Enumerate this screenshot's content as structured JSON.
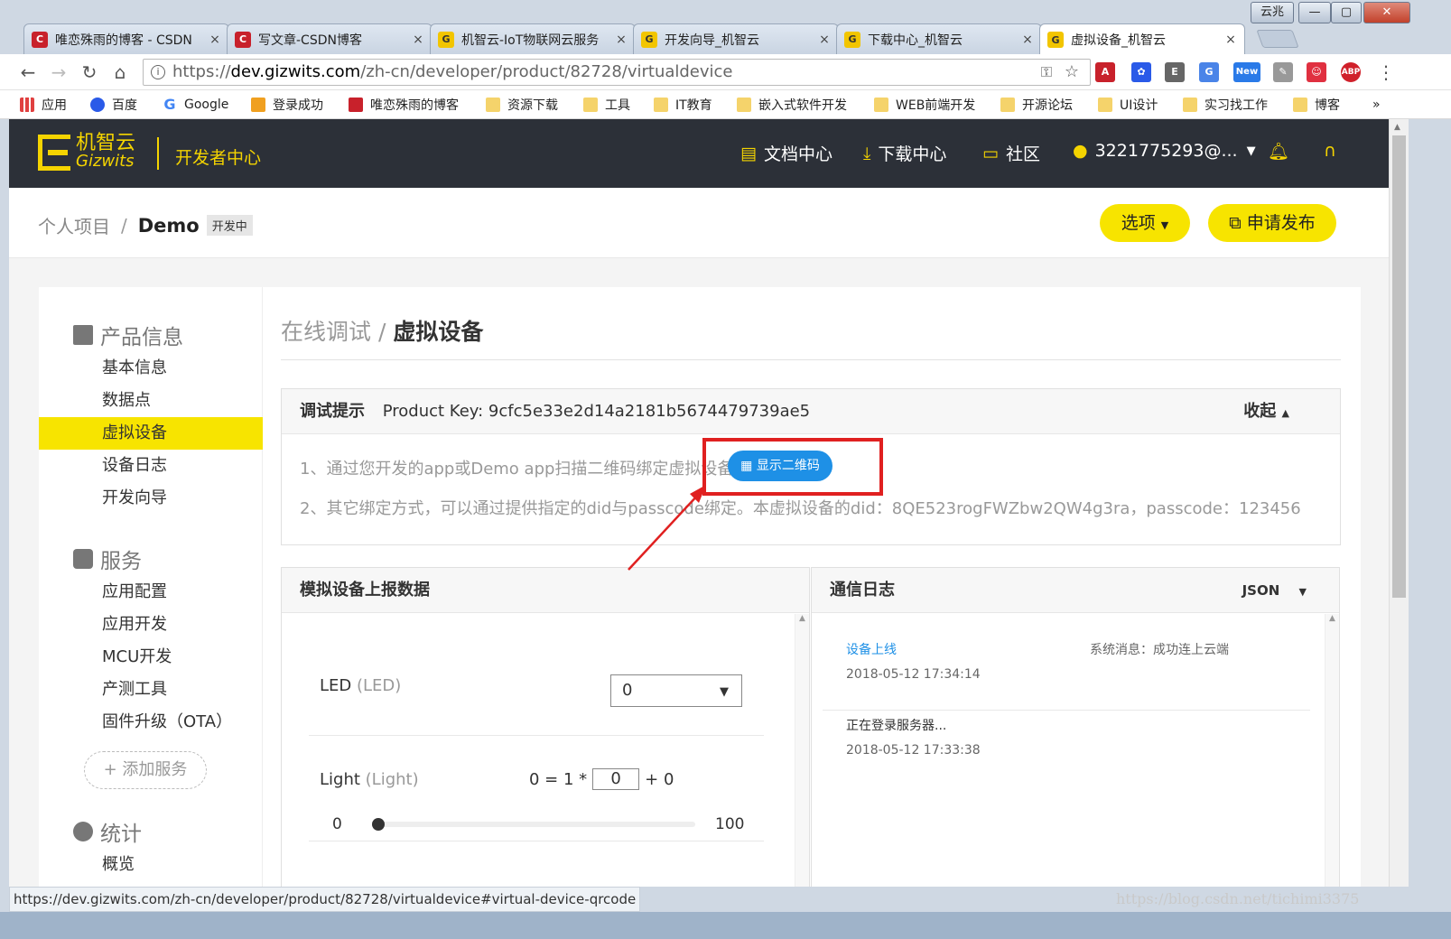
{
  "window": {
    "title_btn": "云兆",
    "min": "—",
    "max": "▢",
    "close": "✕"
  },
  "tabs": [
    {
      "label": "唯恋殊雨的博客 - CSDN",
      "favicon": "c"
    },
    {
      "label": "写文章-CSDN博客",
      "favicon": "c"
    },
    {
      "label": "机智云-IoT物联网云服务",
      "favicon": "g"
    },
    {
      "label": "开发向导_机智云",
      "favicon": "g"
    },
    {
      "label": "下载中心_机智云",
      "favicon": "g"
    },
    {
      "label": "虚拟设备_机智云",
      "favicon": "g",
      "active": true
    }
  ],
  "tab_close": "×",
  "address": {
    "scheme": "https://",
    "host": "dev.gizwits.com",
    "path": "/zh-cn/developer/product/82728/virtualdevice"
  },
  "bookmarks": [
    {
      "label": "应用",
      "icon": "apps-grid"
    },
    {
      "label": "百度",
      "icon": "baidu-paw"
    },
    {
      "label": "Google",
      "icon": "google-g"
    },
    {
      "label": "登录成功",
      "icon": "ep"
    },
    {
      "label": "唯恋殊雨的博客",
      "icon": "csdn-c"
    },
    {
      "label": "资源下载",
      "icon": "folder"
    },
    {
      "label": "工具",
      "icon": "folder"
    },
    {
      "label": "IT教育",
      "icon": "folder"
    },
    {
      "label": "嵌入式软件开发",
      "icon": "folder"
    },
    {
      "label": "WEB前端开发",
      "icon": "folder"
    },
    {
      "label": "开源论坛",
      "icon": "folder"
    },
    {
      "label": "UI设计",
      "icon": "folder"
    },
    {
      "label": "实习找工作",
      "icon": "folder"
    },
    {
      "label": "博客",
      "icon": "folder"
    }
  ],
  "bookmarks_more": "»",
  "header": {
    "logo_cn": "机智云",
    "logo_en": "Gizwits",
    "dev_center": "开发者中心",
    "nav": [
      "文档中心",
      "下载中心",
      "社区"
    ],
    "user": "3221775293@..."
  },
  "breadcrumb": {
    "root": "个人项目",
    "sep": "/",
    "project": "Demo",
    "tag": "开发中"
  },
  "actions": {
    "options": "选项",
    "publish": "申请发布"
  },
  "sidebar": {
    "sections": [
      {
        "title": "产品信息",
        "items": [
          "基本信息",
          "数据点",
          "虚拟设备",
          "设备日志",
          "开发向导"
        ]
      },
      {
        "title": "服务",
        "items": [
          "应用配置",
          "应用开发",
          "MCU开发",
          "产测工具",
          "固件升级（OTA）"
        ]
      },
      {
        "title": "统计",
        "items": [
          "概览"
        ]
      }
    ],
    "add_service": "+ 添加服务",
    "active": "虚拟设备"
  },
  "page": {
    "title_prefix": "在线调试",
    "title_sep": "/",
    "title": "虚拟设备"
  },
  "debug": {
    "label": "调试提示",
    "product_key": "Product Key: 9cfc5e33e2d14a2181b5674479739ae5",
    "collapse": "收起",
    "hint1": "1、通过您开发的app或Demo app扫描二维码绑定虚拟设备。",
    "show_qr": "显示二维码",
    "hint2": "2、其它绑定方式，可以通过提供指定的did与passcode绑定。本虚拟设备的did：8QE523rogFWZbw2QW4g3ra，passcode：123456"
  },
  "report": {
    "title": "模拟设备上报数据",
    "led_label": "LED",
    "led_key": "(LED)",
    "led_value": "0",
    "light_label": "Light",
    "light_key": "(Light)",
    "formula_prefix": "0 = 1 *",
    "formula_value": "0",
    "formula_suffix": "+ 0",
    "slider_min": "0",
    "slider_max": "100",
    "slider_value": 0
  },
  "log": {
    "title": "通信日志",
    "format": "JSON",
    "entries": [
      {
        "event": "设备上线",
        "message": "系统消息：成功连上云端",
        "time": "2018-05-12 17:34:14"
      },
      {
        "event": "正在登录服务器...",
        "message": "",
        "time": "2018-05-12 17:33:38"
      }
    ]
  },
  "statusbar": "https://dev.gizwits.com/zh-cn/developer/product/82728/virtualdevice#virtual-device-qrcode",
  "watermark": "https://blog.csdn.net/tichimi3375",
  "colors": {
    "accent": "#f7e400",
    "header_bg": "#2c3038",
    "link": "#1e90e6",
    "highlight": "#e02020"
  }
}
